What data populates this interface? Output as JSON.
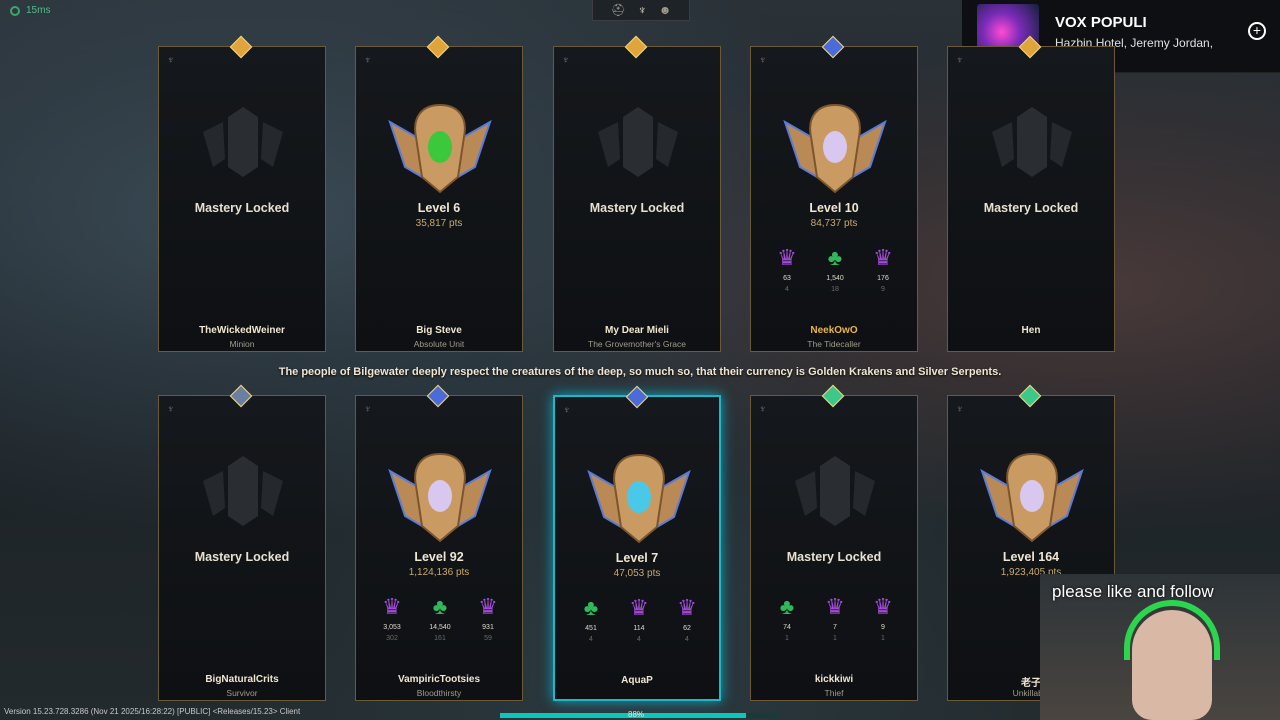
{
  "topbar": {
    "ping": "15ms",
    "tabs": [
      {
        "icon": "helmet-icon",
        "glyph": "⛑",
        "active": false
      },
      {
        "icon": "mastery-crest-icon",
        "glyph": "♆",
        "active": true
      },
      {
        "icon": "profile-icon",
        "glyph": "☻",
        "active": false
      }
    ]
  },
  "music": {
    "title": "VOX POPULI",
    "artist": "Hazbin Hotel, Jeremy Jordan,",
    "add_glyph": "+"
  },
  "lore": "The people of Bilgewater deeply respect the creatures of the deep, so much so, that their currency is Golden Krakens and Silver Serpents.",
  "row1": [
    {
      "locked": true,
      "status": "Mastery Locked",
      "name": "TheWickedWeiner",
      "sub": "Minion",
      "gem_color": "#e0a43c"
    },
    {
      "locked": false,
      "level": "Level 6",
      "pts": "35,817 pts",
      "name": "Big Steve",
      "sub": "Absolute Unit",
      "gem_color": "#e0a43c",
      "crest_gem": "#3cc83c"
    },
    {
      "locked": true,
      "status": "Mastery Locked",
      "name": "My Dear Mieli",
      "sub": "The Grovemother's Grace",
      "gem_color": "#e0a43c"
    },
    {
      "locked": false,
      "level": "Level 10",
      "pts": "84,737 pts",
      "name": "NeekOwO",
      "sub": "The Tidecaller",
      "gem_color": "#4a6bd8",
      "crest_gem": "#d8c8f0",
      "highlight": true,
      "marks": [
        {
          "type": "purple",
          "glyph": "♛",
          "value": "63",
          "sub": "4"
        },
        {
          "type": "green",
          "glyph": "♣",
          "value": "1,540",
          "sub": "18"
        },
        {
          "type": "purple",
          "glyph": "♛",
          "value": "176",
          "sub": "9"
        }
      ]
    },
    {
      "locked": true,
      "status": "Mastery Locked",
      "name": "Hen",
      "sub": "",
      "gem_color": "#e0a43c"
    }
  ],
  "row2": [
    {
      "locked": true,
      "status": "Mastery Locked",
      "name": "BigNaturalCrits",
      "sub": "Survivor",
      "gem_color": "#6b7fa0"
    },
    {
      "locked": false,
      "level": "Level 92",
      "pts": "1,124,136 pts",
      "name": "VampiricTootsies",
      "sub": "Bloodthirsty",
      "gem_color": "#4a6bd8",
      "crest_gem": "#d8c8f0",
      "marks": [
        {
          "type": "purple",
          "glyph": "♛",
          "value": "3,053",
          "sub": "302"
        },
        {
          "type": "green",
          "glyph": "♣",
          "value": "14,540",
          "sub": "161"
        },
        {
          "type": "purple",
          "glyph": "♛",
          "value": "931",
          "sub": "59"
        }
      ]
    },
    {
      "locked": false,
      "selected": true,
      "level": "Level 7",
      "pts": "47,053 pts",
      "name": "AquaP",
      "sub": "",
      "gem_color": "#4a6bd8",
      "crest_gem": "#4ac8e8",
      "marks": [
        {
          "type": "green",
          "glyph": "♣",
          "value": "451",
          "sub": "4"
        },
        {
          "type": "purple",
          "glyph": "♛",
          "value": "114",
          "sub": "4"
        },
        {
          "type": "purple",
          "glyph": "♛",
          "value": "62",
          "sub": "4"
        }
      ]
    },
    {
      "locked": true,
      "status": "Mastery Locked",
      "name": "kickkiwi",
      "sub": "Thief",
      "gem_color": "#3cc88a",
      "marks": [
        {
          "type": "green",
          "glyph": "♣",
          "value": "74",
          "sub": "1"
        },
        {
          "type": "purple",
          "glyph": "♛",
          "value": "7",
          "sub": "1"
        },
        {
          "type": "purple",
          "glyph": "♛",
          "value": "9",
          "sub": "1"
        }
      ]
    },
    {
      "locked": false,
      "level": "Level 164",
      "pts": "1,923,405 pts",
      "name": "老子",
      "sub": "Unkillable",
      "gem_color": "#3cc88a",
      "crest_gem": "#d8c8f0"
    }
  ],
  "footer": {
    "version": "Version 15.23.728.3286 (Nov 21 2025/16:28:22) [PUBLIC] <Releases/15.23> Client",
    "progress_label": "88%",
    "progress": 0.88
  },
  "webcam": {
    "caption": "please like and follow"
  }
}
